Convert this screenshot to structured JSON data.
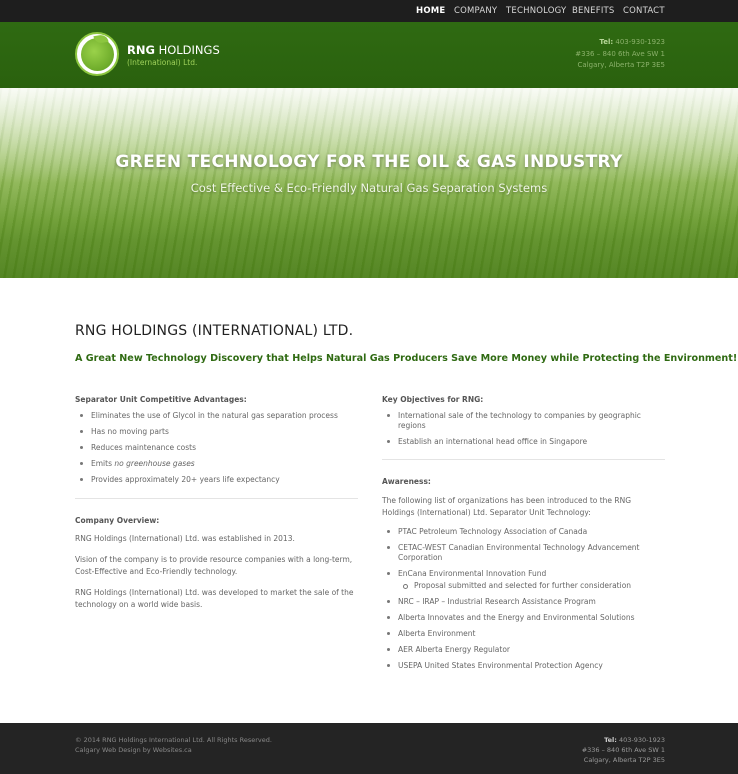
{
  "nav": {
    "items": [
      "HOME",
      "COMPANY",
      "TECHNOLOGY",
      "BENEFITS",
      "CONTACT"
    ]
  },
  "header": {
    "brand_bold": "RNG",
    "brand_rest": " HOLDINGS",
    "brand_sub": "(International) Ltd.",
    "tel_label": "Tel:",
    "tel": " 403-930-1923",
    "address1": "#336 – 840 6th Ave SW 1",
    "address2": "Calgary, Alberta T2P 3E5"
  },
  "hero": {
    "title": "GREEN TECHNOLOGY FOR THE OIL & GAS INDUSTRY",
    "subtitle": "Cost Effective & Eco-Friendly Natural Gas Separation Systems"
  },
  "main": {
    "title": "RNG HOLDINGS (INTERNATIONAL) LTD.",
    "tagline": "A Great New Technology Discovery that Helps Natural Gas Producers Save More Money while Protecting the Environment!",
    "advantages": {
      "title": "Separator Unit Competitive Advantages:",
      "items": [
        "Eliminates the use of Glycol in the natural gas separation process",
        "Has no moving parts",
        "Reduces maintenance costs",
        "Emits ",
        "Provides approximately 20+ years life expectancy"
      ],
      "emits_em": "no greenhouse gases"
    },
    "overview": {
      "title": "Company Overview:",
      "paragraphs": [
        "RNG Holdings (International) Ltd. was established in 2013.",
        "Vision of the company is to provide resource companies with a long-term, Cost-Effective and Eco-Friendly technology.",
        "RNG Holdings (International) Ltd. was developed to market the sale of the technology on a world wide basis."
      ]
    },
    "objectives": {
      "title": "Key Objectives for RNG:",
      "items": [
        "International sale of the technology to companies by geographic regions",
        "Establish an international head office in Singapore"
      ]
    },
    "awareness": {
      "title": "Awareness:",
      "intro": "The following list of organizations has been introduced to the RNG Holdings (International) Ltd. Separator Unit Technology:",
      "items": [
        "PTAC Petroleum Technology Association of Canada",
        "CETAC-WEST Canadian Environmental Technology Advancement Corporation",
        "EnCana Environmental Innovation Fund",
        "NRC – IRAP – Industrial Research Assistance Program",
        "Alberta Innovates and the Energy and Environmental Solutions",
        "Alberta Environment",
        "AER Alberta Energy Regulator",
        "USEPA United States Environmental Protection Agency"
      ],
      "encana_sub": "Proposal submitted and selected for further consideration"
    }
  },
  "footer": {
    "copyright": "© 2014 RNG Holdings International Ltd. All Rights Reserved.",
    "credit": "Calgary Web Design by Websites.ca",
    "tel_label": "Tel:",
    "tel": " 403-930-1923",
    "address1": "#336 – 840 6th Ave SW 1",
    "address2": "Calgary, Alberta T2P 3E5"
  },
  "colors": {
    "header_green": "#2f6a12",
    "accent_green": "#8cc63f",
    "nav_bg": "#1e1e1e",
    "footer_bg": "#242424"
  }
}
